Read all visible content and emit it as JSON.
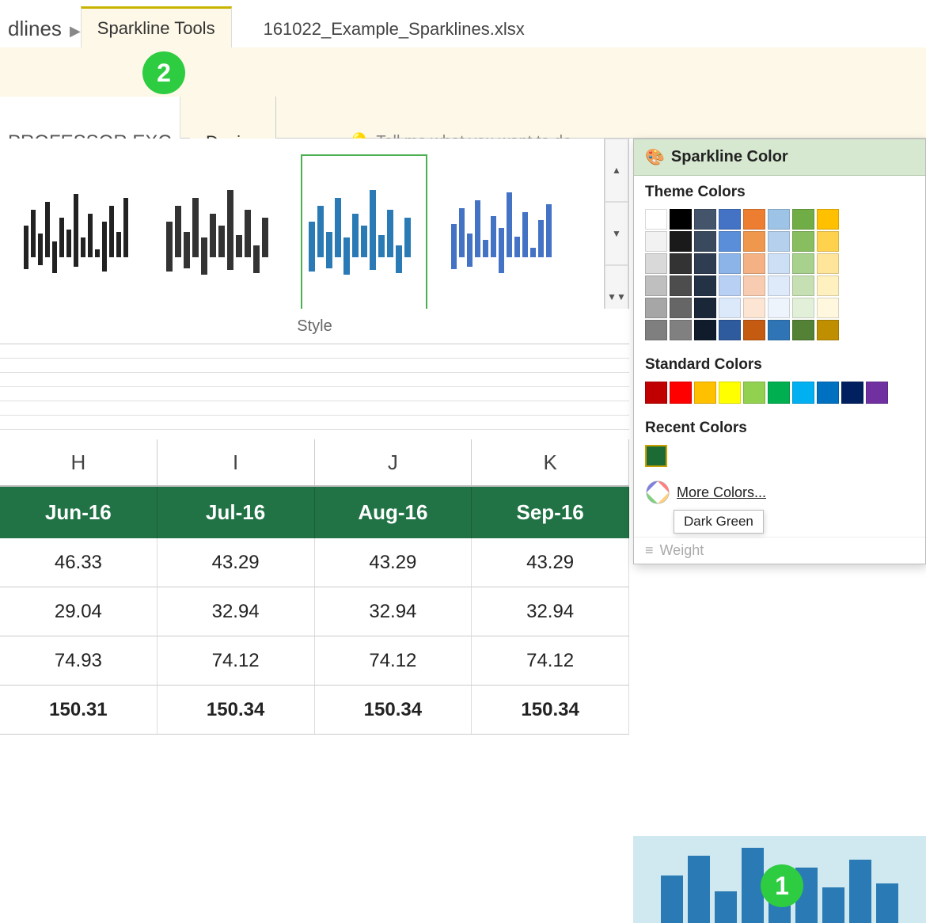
{
  "title_bar": {
    "dlines_label": "dlines",
    "arrow": "▶",
    "sparkline_tools": "Sparkline Tools",
    "filename": "161022_Example_Sparklines.xlsx"
  },
  "ribbon": {
    "professor_label": "PROFESSOR EXC",
    "design_label": "Design",
    "tell_me_placeholder": "Tell me what you want to do",
    "badge2_label": "2"
  },
  "style_label": "Style",
  "column_headers": [
    "H",
    "I",
    "J",
    "K"
  ],
  "table_header": [
    "Jun-16",
    "Jul-16",
    "Aug-16",
    "Sep-16"
  ],
  "data_rows": [
    [
      "46.33",
      "43.29",
      "43.29",
      "43.29"
    ],
    [
      "29.04",
      "32.94",
      "32.94",
      "32.94"
    ],
    [
      "74.93",
      "74.12",
      "74.12",
      "74.12"
    ],
    [
      "150.31",
      "150.34",
      "150.34",
      "150.34"
    ]
  ],
  "color_panel": {
    "header_label": "Sparkline Color",
    "theme_colors_label": "Theme Colors",
    "standard_colors_label": "Standard Colors",
    "recent_colors_label": "Recent Colors",
    "more_colors_label": "More Colors...",
    "dark_green_tooltip": "Dark Green",
    "weight_label": "Weight"
  },
  "theme_colors": {
    "columns": [
      [
        "#ffffff",
        "#f2f2f2",
        "#d9d9d9",
        "#bfbfbf",
        "#a6a6a6",
        "#7f7f7f"
      ],
      [
        "#000000",
        "#1a1a1a",
        "#333333",
        "#4d4d4d",
        "#666666",
        "#808080"
      ],
      [
        "#1f3864",
        "#1f497d",
        "#215868",
        "#1f497d",
        "#17375e",
        "#0d2040"
      ],
      [
        "#2e75b6",
        "#4472c4",
        "#5b9bd5",
        "#4472c4",
        "#2f5496",
        "#1f3864"
      ],
      [
        "#ed7d31",
        "#f4b183",
        "#f7caac",
        "#ed7d31",
        "#c55a11",
        "#843c0c"
      ],
      [
        "#4472c4",
        "#9dc3e6",
        "#bdd7ee",
        "#4472c4",
        "#2f5496",
        "#1f3864"
      ],
      [
        "#70ad47",
        "#a9d18e",
        "#c6e0b4",
        "#70ad47",
        "#538135",
        "#375623"
      ],
      [
        "#ffc000",
        "#ffd966",
        "#ffe699",
        "#ffc000",
        "#bf8f00",
        "#806000"
      ]
    ]
  },
  "standard_colors": [
    "#c00000",
    "#ff0000",
    "#ffc000",
    "#ffff00",
    "#92d050",
    "#00b050",
    "#00b0f0",
    "#0070c0",
    "#002060",
    "#7030a0"
  ],
  "recent_color": "#1d6b34",
  "bar_chart_bars": [
    60,
    85,
    40,
    95,
    55,
    70,
    45,
    80,
    50
  ],
  "badge1_label": "1"
}
